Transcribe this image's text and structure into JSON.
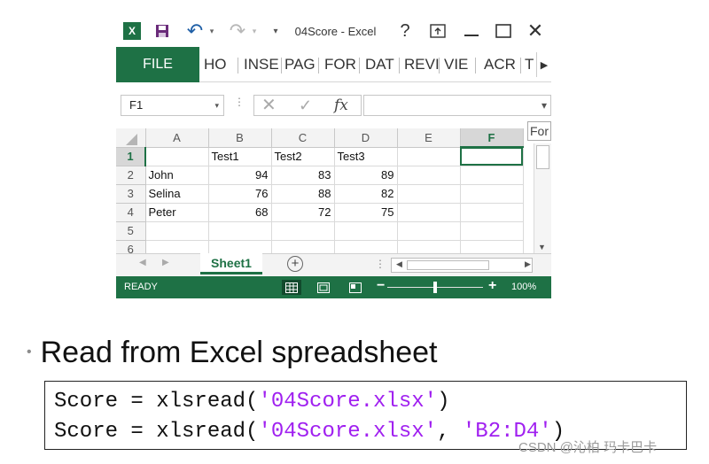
{
  "excel": {
    "title": "04Score - Excel",
    "icons": {
      "app": "excel-logo-icon",
      "save": "save-icon",
      "undo": "undo-icon",
      "redo": "redo-icon",
      "help": "help-icon",
      "ribbon_options": "ribbon-display-options-icon",
      "minimize": "minimize-icon",
      "maximize": "maximize-icon",
      "close": "close-icon"
    },
    "brand_color": "#1e7145",
    "glyphs": {
      "excel_logo": "X",
      "undo": "↶",
      "redo": "↷",
      "dropdown": "▾",
      "help": "?",
      "close": "✕",
      "cancel": "✕",
      "enter": "✓",
      "fx": "fx",
      "dots": "⋮",
      "scroll_right": "▶",
      "scroll_down": "▼",
      "tab_prev": "◀",
      "tab_next": "▶",
      "add_sheet": "+",
      "hscroll_left": "◀",
      "hscroll_right": "▶",
      "zoom_minus": "−",
      "zoom_plus": "+"
    },
    "ribbon": {
      "file": "FILE",
      "tabs": [
        "HO",
        "INSE",
        "PAG",
        "FOR",
        "DAT",
        "REVI",
        "VIE",
        "ACR",
        "T"
      ]
    },
    "formula_bar": {
      "name_box": "F1",
      "content": "",
      "tooltip": "For"
    },
    "sheet": {
      "columns": [
        "A",
        "B",
        "C",
        "D",
        "E",
        "F"
      ],
      "selected_column": "F",
      "selected_row": "1",
      "active_cell": "F1",
      "rows": [
        {
          "num": "1",
          "cells": [
            "",
            "Test1",
            "Test2",
            "Test3",
            "",
            ""
          ]
        },
        {
          "num": "2",
          "cells": [
            "John",
            "94",
            "83",
            "89",
            "",
            ""
          ]
        },
        {
          "num": "3",
          "cells": [
            "Selina",
            "76",
            "88",
            "82",
            "",
            ""
          ]
        },
        {
          "num": "4",
          "cells": [
            "Peter",
            "68",
            "72",
            "75",
            "",
            ""
          ]
        },
        {
          "num": "5",
          "cells": [
            "",
            "",
            "",
            "",
            "",
            ""
          ]
        },
        {
          "num": "6",
          "cells": [
            "",
            "",
            "",
            "",
            "",
            ""
          ]
        }
      ]
    },
    "sheet_tabs": [
      "Sheet1"
    ],
    "status": {
      "ready": "READY",
      "zoom": "100%",
      "zoom_fraction": 0.5,
      "views": [
        "normal-view-icon",
        "page-layout-view-icon",
        "page-break-preview-icon"
      ]
    }
  },
  "slide": {
    "bullet": "•",
    "bullet_text": "Read from Excel spreadsheet",
    "code": [
      {
        "plain": "Score = xlsread(",
        "str1": "'04Score.xlsx'",
        "sep": "",
        "str2": "",
        "close": ")"
      },
      {
        "plain": "Score = xlsread(",
        "str1": "'04Score.xlsx'",
        "sep": ", ",
        "str2": "'B2:D4'",
        "close": ")"
      }
    ],
    "string_color": "#a020f0",
    "watermark": "CSDN @沁柏 玛卡巴卡"
  }
}
